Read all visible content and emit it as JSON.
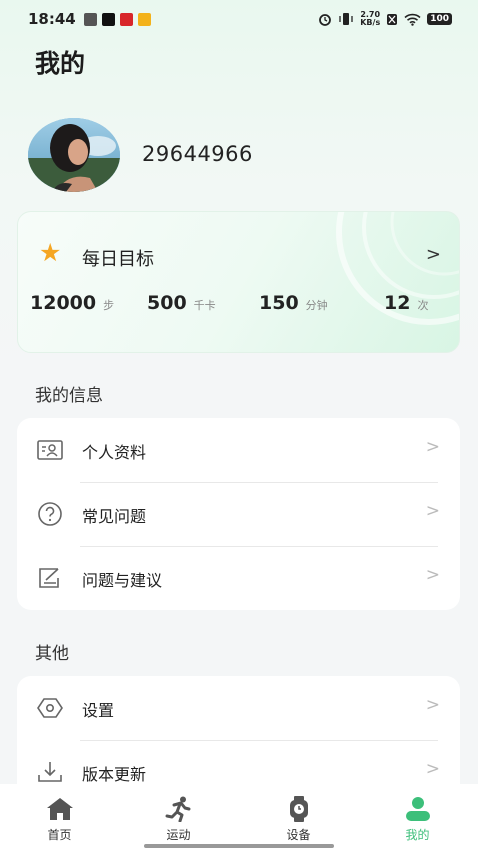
{
  "status_bar": {
    "time": "18:44",
    "net_speed_value": "2.70",
    "net_speed_unit": "KB/s",
    "battery": "100"
  },
  "page": {
    "title": "我的"
  },
  "profile": {
    "user_id": "29644966"
  },
  "daily_goal": {
    "title": "每日目标",
    "arrow": ">",
    "stats": [
      {
        "value": "12000",
        "unit": "步"
      },
      {
        "value": "500",
        "unit": "千卡"
      },
      {
        "value": "150",
        "unit": "分钟"
      },
      {
        "value": "12",
        "unit": "次"
      }
    ]
  },
  "my_info": {
    "title": "我的信息",
    "items": [
      {
        "label": "个人资料",
        "icon": "profile-card-icon"
      },
      {
        "label": "常见问题",
        "icon": "question-icon"
      },
      {
        "label": "问题与建议",
        "icon": "feedback-icon"
      }
    ]
  },
  "other": {
    "title": "其他",
    "items": [
      {
        "label": "设置",
        "icon": "settings-icon"
      },
      {
        "label": "版本更新",
        "icon": "download-icon"
      }
    ]
  },
  "chevron": ">",
  "bottom_nav": {
    "items": [
      {
        "label": "首页",
        "icon": "home-icon"
      },
      {
        "label": "运动",
        "icon": "running-icon"
      },
      {
        "label": "设备",
        "icon": "watch-icon"
      },
      {
        "label": "我的",
        "icon": "person-icon",
        "active": true
      }
    ]
  },
  "colors": {
    "accent": "#3cbf7a",
    "star": "#f5a623"
  }
}
